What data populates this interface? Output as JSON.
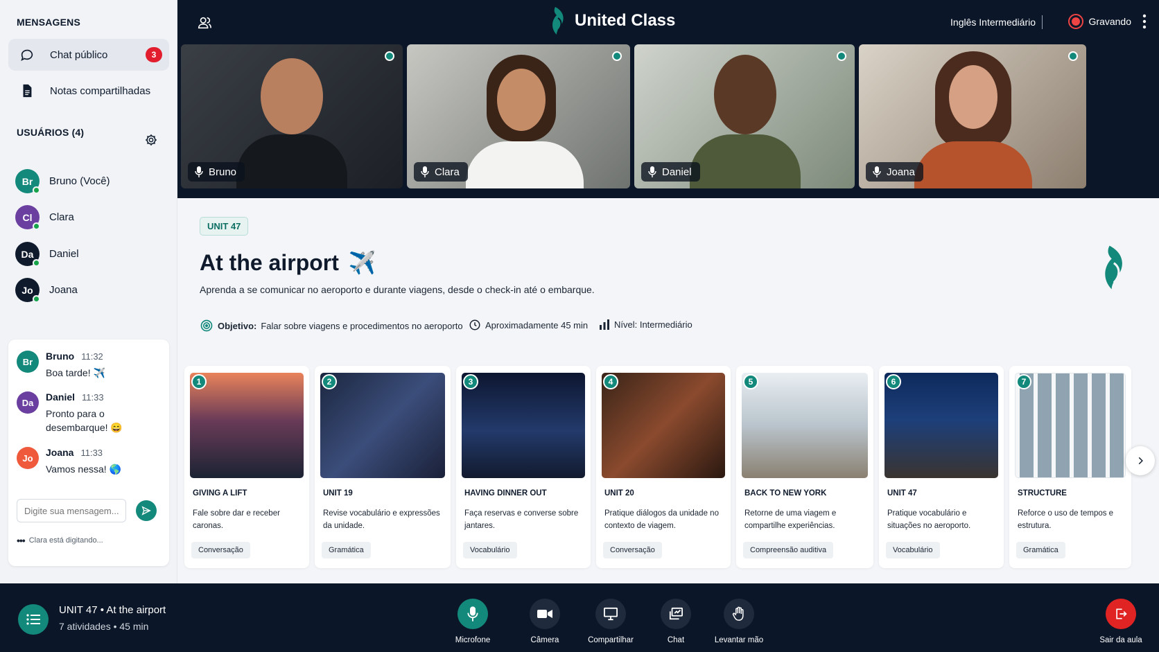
{
  "sidebar": {
    "messages_title": "MENSAGENS",
    "nav": [
      {
        "label": "Chat público",
        "icon": "chat-bubble-icon",
        "badge": "3"
      },
      {
        "label": "Notas compartilhadas",
        "icon": "document-icon"
      }
    ],
    "users_title": "USUÁRIOS (4)",
    "users": [
      {
        "initials": "Br",
        "name": "Bruno (Você)",
        "color": "#13897c"
      },
      {
        "initials": "Cl",
        "name": "Clara",
        "color": "#6b3fa0"
      },
      {
        "initials": "Da",
        "name": "Daniel",
        "color": "#0f1b2d"
      },
      {
        "initials": "Jo",
        "name": "Joana",
        "color": "#0f1b2d"
      }
    ]
  },
  "chat": {
    "messages": [
      {
        "initials": "Br",
        "name": "Bruno",
        "time": "11:32",
        "text": "Boa tarde! ✈️",
        "color": "#13897c"
      },
      {
        "initials": "Da",
        "name": "Daniel",
        "time": "11:33",
        "text": "Pronto para o desembarque! 😄",
        "color": "#6b3fa0"
      },
      {
        "initials": "Jo",
        "name": "Joana",
        "time": "11:33",
        "text": "Vamos nessa! 🌎",
        "color": "#ef5a3c"
      }
    ],
    "input_placeholder": "Digite sua mensagem...",
    "typing": "Clara está digitando..."
  },
  "header": {
    "brand": "United Class",
    "course": "Inglês Intermediário",
    "recording": "Gravando"
  },
  "videos": [
    {
      "name": "Bruno"
    },
    {
      "name": "Clara"
    },
    {
      "name": "Daniel"
    },
    {
      "name": "Joana"
    }
  ],
  "lesson": {
    "unit": "UNIT 47",
    "title": "At the airport",
    "title_icon": "✈️",
    "description": "Aprenda a se comunicar no aeroporto e durante viagens, desde o check-in até o embarque.",
    "objective_label": "Objetivo:",
    "objective": "Falar sobre viagens e procedimentos no aeroporto",
    "duration": "Aproximadamente 45 min",
    "level": "Nível: Intermediário"
  },
  "activities": [
    {
      "num": "1",
      "title": "GIVING A LIFT",
      "desc": "Fale sobre dar e receber caronas.",
      "tag": "Conversação"
    },
    {
      "num": "2",
      "title": "UNIT 19",
      "desc": "Revise vocabulário e expressões da unidade.",
      "tag": "Gramática"
    },
    {
      "num": "3",
      "title": "HAVING DINNER OUT",
      "desc": "Faça reservas e converse sobre jantares.",
      "tag": "Vocabulário"
    },
    {
      "num": "4",
      "title": "UNIT 20",
      "desc": "Pratique diálogos da unidade no contexto de viagem.",
      "tag": "Conversação"
    },
    {
      "num": "5",
      "title": "BACK TO NEW YORK",
      "desc": "Retorne de uma viagem e compartilhe experiências.",
      "tag": "Compreensão auditiva"
    },
    {
      "num": "6",
      "title": "UNIT 47",
      "desc": "Pratique vocabulário e situações no aeroporto.",
      "tag": "Vocabulário"
    },
    {
      "num": "7",
      "title": "STRUCTURE",
      "desc": "Reforce o uso de tempos e estrutura.",
      "tag": "Gramática"
    }
  ],
  "footer": {
    "title": "UNIT 47  •  At the airport",
    "subtitle": "7 atividades  •  45 min",
    "controls": {
      "mic": "Microfone",
      "camera": "Câmera",
      "share": "Compartilhar",
      "chat": "Chat",
      "hand": "Levantar mão",
      "leave": "Sair da aula"
    }
  },
  "colors": {
    "accent": "#13897c",
    "dark": "#0b1628",
    "danger": "#e02424"
  }
}
